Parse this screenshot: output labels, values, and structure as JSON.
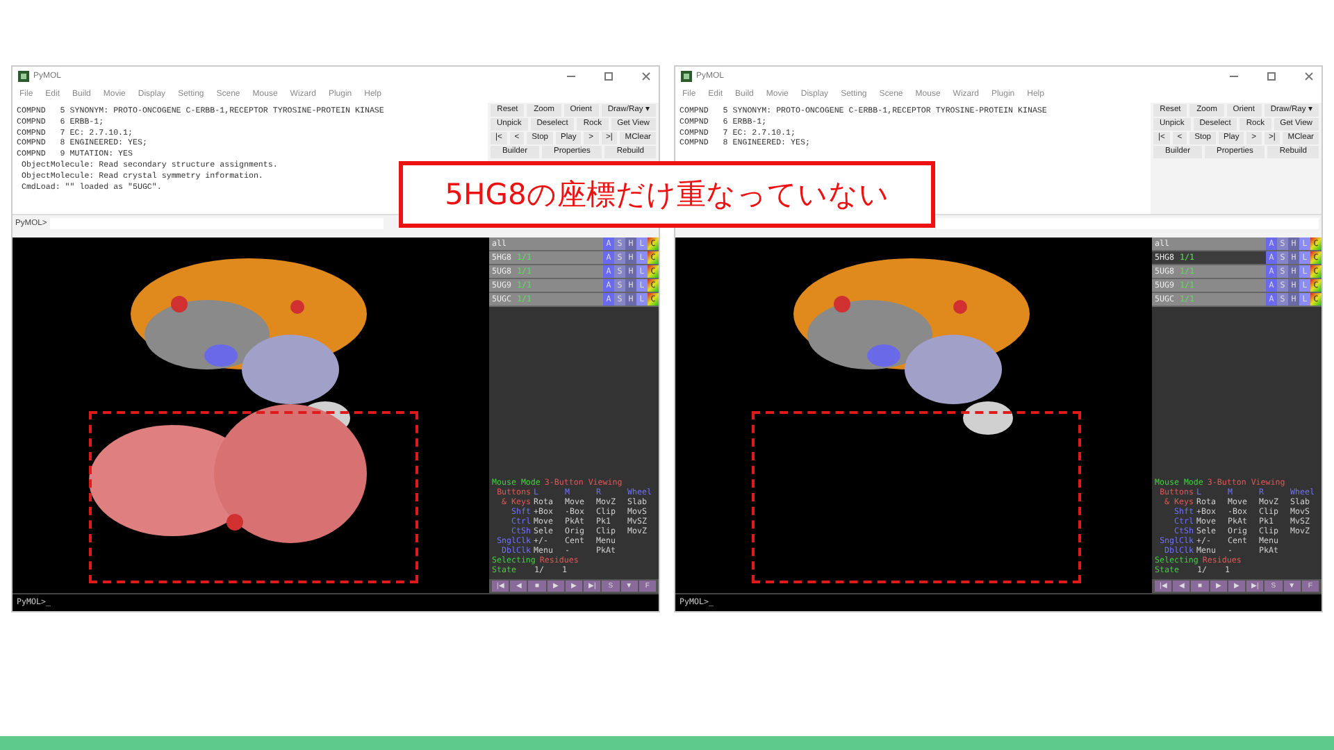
{
  "windows": [
    {
      "title": "PyMOL",
      "menu": [
        "File",
        "Edit",
        "Build",
        "Movie",
        "Display",
        "Setting",
        "Scene",
        "Mouse",
        "Wizard",
        "Plugin",
        "Help"
      ],
      "log": [
        "COMPND   5 SYNONYM: PROTO-ONCOGENE C-ERBB-1,RECEPTOR TYROSINE-PROTEIN KINASE",
        "COMPND   6 ERBB-1;",
        "COMPND   7 EC: 2.7.10.1;",
        "COMPND   8 ENGINEERED: YES;",
        "COMPND   9 MUTATION: YES",
        " ObjectMolecule: Read secondary structure assignments.",
        " ObjectMolecule: Read crystal symmetry information.",
        " CmdLoad: \"\" loaded as \"5UGC\"."
      ],
      "button_rows": [
        [
          "Reset",
          "Zoom",
          "Orient",
          "Draw/Ray ▾"
        ],
        [
          "Unpick",
          "Deselect",
          "Rock",
          "Get View"
        ],
        [
          "|<",
          "<",
          "Stop",
          "Play",
          ">",
          ">|",
          "MClear"
        ],
        [
          "Builder",
          "Properties",
          "Rebuild"
        ]
      ],
      "command_prompt": "PyMOL>",
      "objects": [
        {
          "name": "all",
          "enabled": true,
          "controls": [
            "A",
            "S",
            "H",
            "L",
            "C"
          ]
        },
        {
          "name": "5HG8",
          "state": "1/1",
          "enabled": true,
          "controls": [
            "A",
            "S",
            "H",
            "L",
            "C"
          ]
        },
        {
          "name": "5UG8",
          "state": "1/1",
          "enabled": true,
          "controls": [
            "A",
            "S",
            "H",
            "L",
            "C"
          ]
        },
        {
          "name": "5UG9",
          "state": "1/1",
          "enabled": true,
          "controls": [
            "A",
            "S",
            "H",
            "L",
            "C"
          ]
        },
        {
          "name": "5UGC",
          "state": "1/1",
          "enabled": true,
          "controls": [
            "A",
            "S",
            "H",
            "L",
            "C"
          ]
        }
      ],
      "overlaid_structure": true,
      "mouse": {
        "label": "Mouse Mode",
        "mode": "3-Button Viewing",
        "buttons_label": "Buttons",
        "columns": [
          "L",
          "M",
          "R",
          "Wheel"
        ],
        "bindings": [
          {
            "key": "& Keys",
            "actions": [
              "Rota",
              "Move",
              "MovZ",
              "Slab"
            ]
          },
          {
            "key": "Shft",
            "actions": [
              "+Box",
              "-Box",
              "Clip",
              "MovS"
            ]
          },
          {
            "key": "Ctrl",
            "actions": [
              "Move",
              "PkAt",
              "Pk1",
              "MvSZ"
            ]
          },
          {
            "key": "CtSh",
            "actions": [
              "Sele",
              "Orig",
              "Clip",
              "MovZ"
            ]
          },
          {
            "key": "SnglClk",
            "actions": [
              "+/-",
              "Cent",
              "Menu"
            ]
          },
          {
            "key": "DblClk",
            "actions": [
              "Menu",
              "-",
              "PkAt"
            ]
          }
        ],
        "selecting_label": "Selecting",
        "selecting_value": "Residues",
        "state_label": "State",
        "state_value": "1/",
        "state_total": "1"
      },
      "playback": [
        "|◀",
        "◀",
        "■",
        "▶",
        "▶",
        "▶|",
        "S",
        "▼",
        "F"
      ],
      "bottom_prompt": "PyMOL>_"
    },
    {
      "title": "PyMOL",
      "menu": [
        "File",
        "Edit",
        "Build",
        "Movie",
        "Display",
        "Setting",
        "Scene",
        "Mouse",
        "Wizard",
        "Plugin",
        "Help"
      ],
      "log": [
        "COMPND   5 SYNONYM: PROTO-ONCOGENE C-ERBB-1,RECEPTOR TYROSINE-PROTEIN KINASE",
        "COMPND   6 ERBB-1;",
        "COMPND   7 EC: 2.7.10.1;",
        "COMPND   8 ENGINEERED: YES;"
      ],
      "button_rows": [
        [
          "Reset",
          "Zoom",
          "Orient",
          "Draw/Ray ▾"
        ],
        [
          "Unpick",
          "Deselect",
          "Rock",
          "Get View"
        ],
        [
          "|<",
          "<",
          "Stop",
          "Play",
          ">",
          ">|",
          "MClear"
        ],
        [
          "Builder",
          "Properties",
          "Rebuild"
        ]
      ],
      "objects": [
        {
          "name": "all",
          "enabled": true,
          "controls": [
            "A",
            "S",
            "H",
            "L",
            "C"
          ]
        },
        {
          "name": "5HG8",
          "state": "1/1",
          "enabled": false,
          "controls": [
            "A",
            "S",
            "H",
            "L",
            "C"
          ]
        },
        {
          "name": "5UG8",
          "state": "1/1",
          "enabled": true,
          "controls": [
            "A",
            "S",
            "H",
            "L",
            "C"
          ]
        },
        {
          "name": "5UG9",
          "state": "1/1",
          "enabled": true,
          "controls": [
            "A",
            "S",
            "H",
            "L",
            "C"
          ]
        },
        {
          "name": "5UGC",
          "state": "1/1",
          "enabled": true,
          "controls": [
            "A",
            "S",
            "H",
            "L",
            "C"
          ]
        }
      ],
      "overlaid_structure": false,
      "mouse": {
        "label": "Mouse Mode",
        "mode": "3-Button Viewing",
        "buttons_label": "Buttons",
        "columns": [
          "L",
          "M",
          "R",
          "Wheel"
        ],
        "bindings": [
          {
            "key": "& Keys",
            "actions": [
              "Rota",
              "Move",
              "MovZ",
              "Slab"
            ]
          },
          {
            "key": "Shft",
            "actions": [
              "+Box",
              "-Box",
              "Clip",
              "MovS"
            ]
          },
          {
            "key": "Ctrl",
            "actions": [
              "Move",
              "PkAt",
              "Pk1",
              "MvSZ"
            ]
          },
          {
            "key": "CtSh",
            "actions": [
              "Sele",
              "Orig",
              "Clip",
              "MovZ"
            ]
          },
          {
            "key": "SnglClk",
            "actions": [
              "+/-",
              "Cent",
              "Menu"
            ]
          },
          {
            "key": "DblClk",
            "actions": [
              "Menu",
              "-",
              "PkAt"
            ]
          }
        ],
        "selecting_label": "Selecting",
        "selecting_value": "Residues",
        "state_label": "State",
        "state_value": "1/",
        "state_total": "1"
      },
      "playback": [
        "|◀",
        "◀",
        "■",
        "▶",
        "▶",
        "▶|",
        "S",
        "▼",
        "F"
      ],
      "bottom_prompt": "PyMOL>_"
    }
  ],
  "callout": "5HG8の座標だけ重なっていない"
}
